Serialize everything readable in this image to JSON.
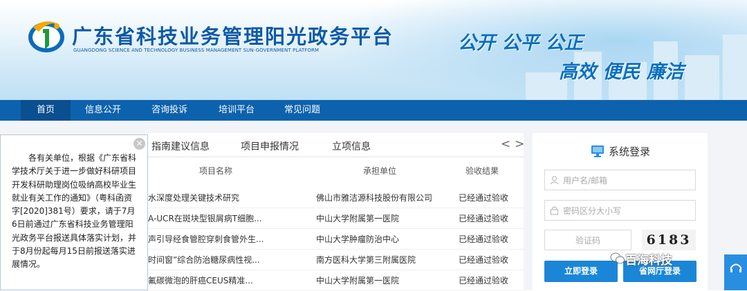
{
  "header": {
    "title": "广东省科技业务管理阳光政务平台",
    "subtitle": "GUANGDONG SCIENCE AND TECHNOLOGY BUSINESS MANAGEMENT SUN-GOVERNMENT PLATFORM",
    "slogan1": "公开  公平  公正",
    "slogan2": "高效  便民  廉洁"
  },
  "nav": {
    "items": [
      "首页",
      "信息公开",
      "咨询投诉",
      "培训平台",
      "常见问题"
    ],
    "active": "首页"
  },
  "notice": {
    "close_symbol": "✕",
    "text": "各有关单位，根据《广东省科学技术厅关于进一步做好科研项目开发科研助理岗位吸纳高校毕业生就业有关工作的通知》（粤科函资字[2020]381号）要求，请于7月6日前通过广东省科技业务管理阳光政务平台报送具体落实计划，并于8月份起每月15日前报送落实进展情况。"
  },
  "tabs": {
    "items": [
      "指南建议信息",
      "项目申报情况",
      "立项信息"
    ],
    "prev": "<",
    "next": ">"
  },
  "table": {
    "headers": [
      "项目名称",
      "承担单位",
      "验收结果"
    ],
    "rows": [
      {
        "name": "水深度处理关键技术研究",
        "org": "佛山市雅洁源科技股份有限公司",
        "result": "已经通过验收"
      },
      {
        "name": "A-UCR在斑块型银屑病T细胞...",
        "org": "中山大学附属第一医院",
        "result": "已经通过验收"
      },
      {
        "name": "声引导经食管腔穿刺食管外生...",
        "org": "中山大学肿瘤防治中心",
        "result": "已经通过验收"
      },
      {
        "name": "时间窗”综合防治糖尿病性视...",
        "org": "南方医科大学第三附属医院",
        "result": "已经通过验收"
      },
      {
        "name": "氟碳微泡的肝癌CEUS精准...",
        "org": "中山大学附属第一医院",
        "result": "已经通过验收"
      }
    ]
  },
  "login": {
    "title": "系统登录",
    "username_placeholder": "用户名/邮箱",
    "password_placeholder": "密码区分大小写",
    "captcha_placeholder": "验证码",
    "captcha_code": "6183",
    "login_button": "立即登录",
    "province_button": "省网厅登录"
  },
  "watermark": "百海科技",
  "colors": {
    "nav_bg": "#0d62ad",
    "nav_active": "#0a4f8f",
    "button": "#1b86d7",
    "title": "#0c5aa6"
  }
}
